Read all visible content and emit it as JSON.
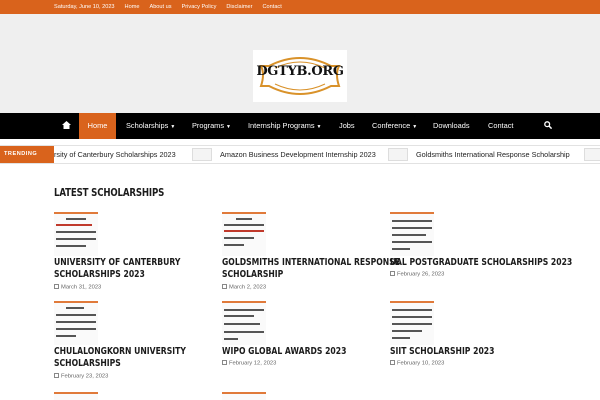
{
  "topbar": {
    "date": "Saturday, June 10, 2023",
    "links": [
      "Home",
      "About us",
      "Privacy Policy",
      "Disclaimer",
      "Contact"
    ]
  },
  "logo": {
    "text": "DGTYB.ORG"
  },
  "nav": {
    "items": [
      {
        "label": "Home",
        "active": true
      },
      {
        "label": "Scholarships",
        "caret": true
      },
      {
        "label": "Programs",
        "caret": true
      },
      {
        "label": "Internship Programs",
        "caret": true
      },
      {
        "label": "Jobs"
      },
      {
        "label": "Conference",
        "caret": true
      },
      {
        "label": "Downloads"
      },
      {
        "label": "Contact"
      }
    ],
    "home_icon": "home-icon",
    "search_icon": "search-icon"
  },
  "trending": {
    "label": "TRENDING",
    "items": [
      "rsity of Canterbury Scholarships 2023",
      "Amazon Business Development Internship 2023",
      "Goldsmiths International Response Scholarship"
    ]
  },
  "section": {
    "title": "LATEST SCHOLARSHIPS"
  },
  "cards": [
    {
      "title1": "UNIVERSITY OF CANTERBURY",
      "title2": "SCHOLARSHIPS 2023",
      "date": "March 31, 2023"
    },
    {
      "title1": "GOLDSMITHS INTERNATIONAL RESPONSE",
      "title2": "SCHOLARSHIP",
      "date": "March 2, 2023"
    },
    {
      "title1": "UAL POSTGRADUATE SCHOLARSHIPS 2023",
      "title2": "",
      "date": "February 26, 2023"
    },
    {
      "title1": "CHULALONGKORN UNIVERSITY",
      "title2": "SCHOLARSHIPS",
      "date": "February 23, 2023"
    },
    {
      "title1": "WIPO GLOBAL AWARDS 2023",
      "title2": "",
      "date": "February 12, 2023"
    },
    {
      "title1": "SIIT SCHOLARSHIP 2023",
      "title2": "",
      "date": "February 10, 2023"
    }
  ],
  "colors": {
    "accent": "#d9631c",
    "nav_bg": "#000000",
    "header_bg": "#efefef"
  }
}
